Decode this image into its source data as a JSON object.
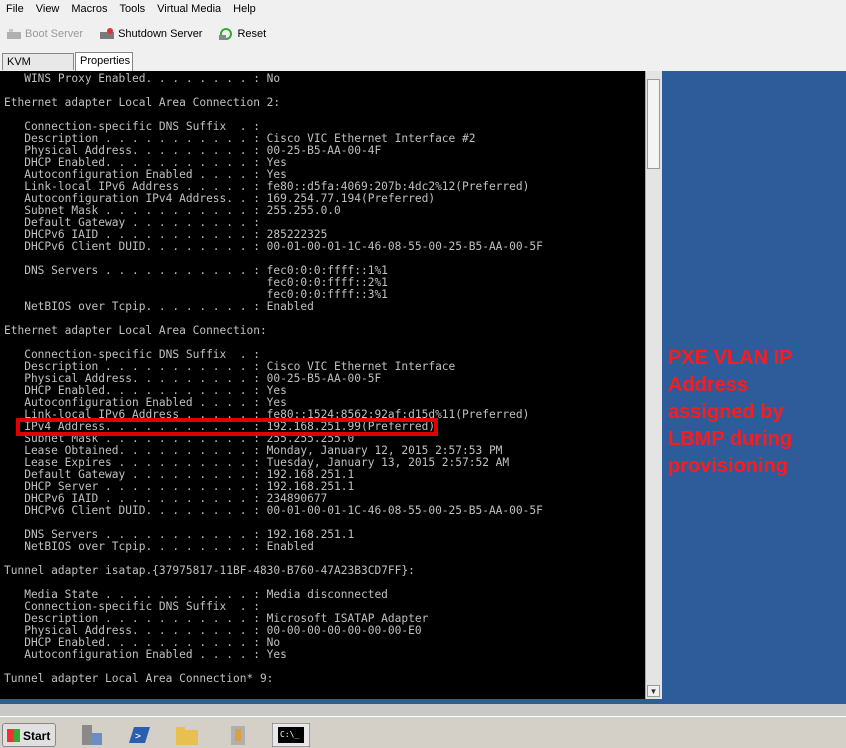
{
  "menu": [
    "File",
    "View",
    "Macros",
    "Tools",
    "Virtual Media",
    "Help"
  ],
  "toolbar": {
    "boot_server": "Boot Server",
    "shutdown_server": "Shutdown Server",
    "reset": "Reset"
  },
  "tabs": {
    "kvm_console": "KVM Console",
    "properties": "Properties"
  },
  "console_lines": [
    "   WINS Proxy Enabled. . . . . . . . : No",
    "",
    "Ethernet adapter Local Area Connection 2:",
    "",
    "   Connection-specific DNS Suffix  . :",
    "   Description . . . . . . . . . . . : Cisco VIC Ethernet Interface #2",
    "   Physical Address. . . . . . . . . : 00-25-B5-AA-00-4F",
    "   DHCP Enabled. . . . . . . . . . . : Yes",
    "   Autoconfiguration Enabled . . . . : Yes",
    "   Link-local IPv6 Address . . . . . : fe80::d5fa:4069:207b:4dc2%12(Preferred)",
    "   Autoconfiguration IPv4 Address. . : 169.254.77.194(Preferred)",
    "   Subnet Mask . . . . . . . . . . . : 255.255.0.0",
    "   Default Gateway . . . . . . . . . :",
    "   DHCPv6 IAID . . . . . . . . . . . : 285222325",
    "   DHCPv6 Client DUID. . . . . . . . : 00-01-00-01-1C-46-08-55-00-25-B5-AA-00-5F",
    "",
    "   DNS Servers . . . . . . . . . . . : fec0:0:0:ffff::1%1",
    "                                       fec0:0:0:ffff::2%1",
    "                                       fec0:0:0:ffff::3%1",
    "   NetBIOS over Tcpip. . . . . . . . : Enabled",
    "",
    "Ethernet adapter Local Area Connection:",
    "",
    "   Connection-specific DNS Suffix  . :",
    "   Description . . . . . . . . . . . : Cisco VIC Ethernet Interface",
    "   Physical Address. . . . . . . . . : 00-25-B5-AA-00-5F",
    "   DHCP Enabled. . . . . . . . . . . : Yes",
    "   Autoconfiguration Enabled . . . . : Yes",
    "   Link-local IPv6 Address . . . . . : fe80::1524:8562:92af:d15d%11(Preferred)",
    "   IPv4 Address. . . . . . . . . . . : 192.168.251.99(Preferred)",
    "   Subnet Mask . . . . . . . . . . . : 255.255.255.0",
    "   Lease Obtained. . . . . . . . . . : Monday, January 12, 2015 2:57:53 PM",
    "   Lease Expires . . . . . . . . . . : Tuesday, January 13, 2015 2:57:52 AM",
    "   Default Gateway . . . . . . . . . : 192.168.251.1",
    "   DHCP Server . . . . . . . . . . . : 192.168.251.1",
    "   DHCPv6 IAID . . . . . . . . . . . : 234890677",
    "   DHCPv6 Client DUID. . . . . . . . : 00-01-00-01-1C-46-08-55-00-25-B5-AA-00-5F",
    "",
    "   DNS Servers . . . . . . . . . . . : 192.168.251.1",
    "   NetBIOS over Tcpip. . . . . . . . : Enabled",
    "",
    "Tunnel adapter isatap.{37975817-11BF-4830-B760-47A23B3CD7FF}:",
    "",
    "   Media State . . . . . . . . . . . : Media disconnected",
    "   Connection-specific DNS Suffix  . :",
    "   Description . . . . . . . . . . . : Microsoft ISATAP Adapter",
    "   Physical Address. . . . . . . . . : 00-00-00-00-00-00-00-E0",
    "   DHCP Enabled. . . . . . . . . . . : No",
    "   Autoconfiguration Enabled . . . . : Yes",
    "",
    "Tunnel adapter Local Area Connection* 9:"
  ],
  "annotation": {
    "text": "PXE VLAN IP Address assigned by LBMP during provisioning",
    "color": "#ff1a1a"
  },
  "taskbar": {
    "start_label": "Start"
  },
  "colors": {
    "highlight_box": "#e00000",
    "desktop": "#2e5b9a"
  }
}
